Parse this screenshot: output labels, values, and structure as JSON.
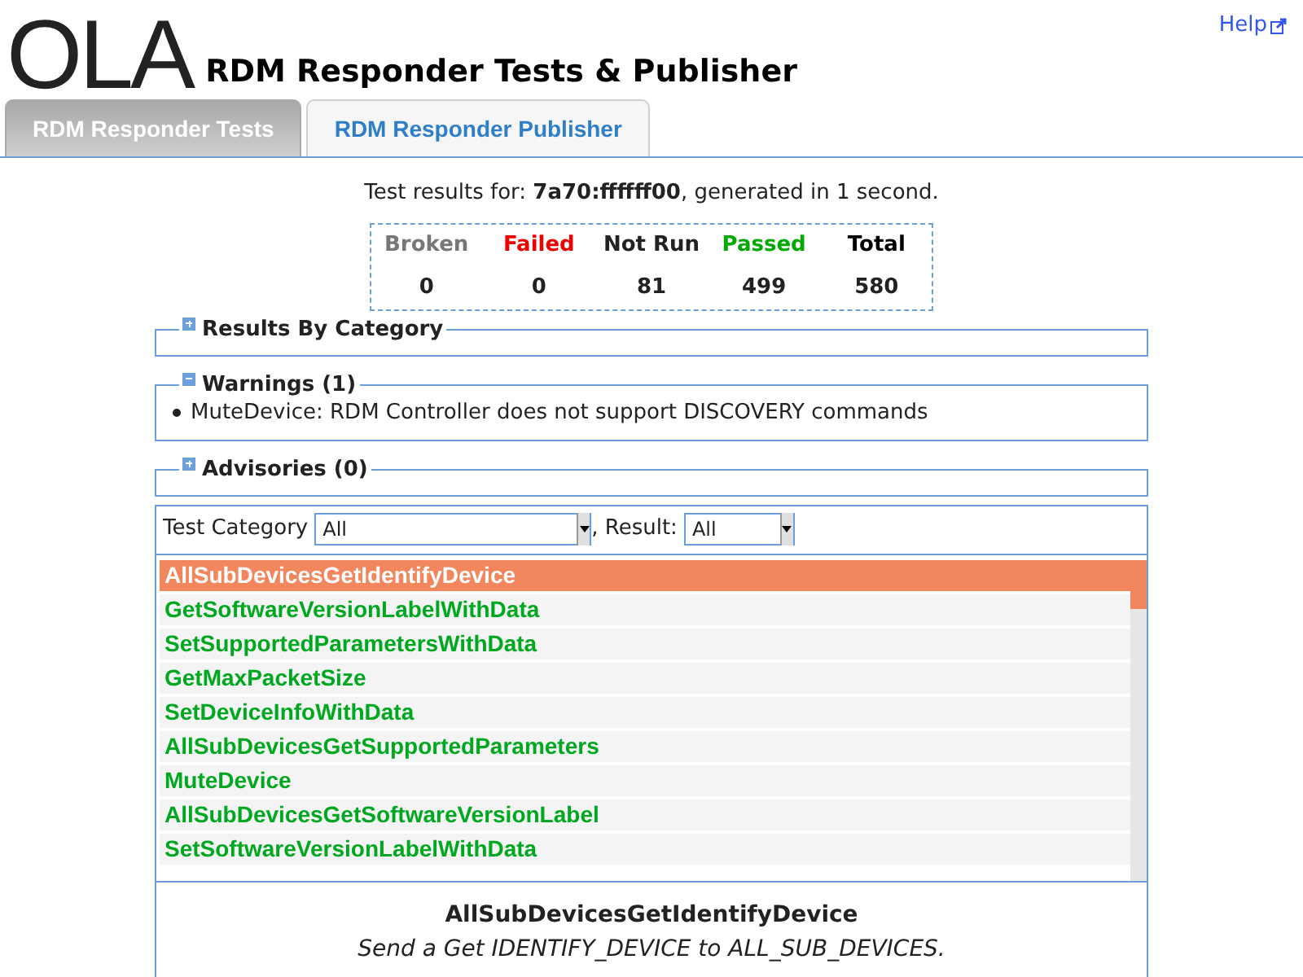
{
  "header": {
    "logo": "OLA",
    "title": "RDM Responder Tests & Publisher",
    "help_link": "Help"
  },
  "tabs": [
    {
      "label": "RDM Responder Tests",
      "selected": true
    },
    {
      "label": "RDM Responder Publisher",
      "selected": false
    }
  ],
  "summary": {
    "prefix": "Test results for: ",
    "uid": "7a70:ffffff00",
    "suffix": ", generated in 1 second."
  },
  "counts": [
    {
      "label": "Broken",
      "value": "0",
      "color": "#777777"
    },
    {
      "label": "Failed",
      "value": "0",
      "color": "#ee0000"
    },
    {
      "label": "Not Run",
      "value": "81",
      "color": "#222222"
    },
    {
      "label": "Passed",
      "value": "499",
      "color": "#00aa00"
    },
    {
      "label": "Total",
      "value": "580",
      "color": "#000000"
    }
  ],
  "sections": [
    {
      "title": "Results By Category",
      "expanded": false
    },
    {
      "title": "Warnings (1)",
      "expanded": true,
      "items": [
        "MuteDevice: RDM Controller does not support DISCOVERY commands"
      ]
    },
    {
      "title": "Advisories (0)",
      "expanded": false
    }
  ],
  "filters": {
    "category_label": "Test Category",
    "category_value": "All",
    "result_label": ", Result:",
    "result_value": "All"
  },
  "tests": [
    {
      "name": "AllSubDevicesGetIdentifyDevice",
      "kind": "passed",
      "selected": true
    },
    {
      "name": "GetSoftwareVersionLabelWithData",
      "kind": "passed",
      "selected": false
    },
    {
      "name": "SetSupportedParametersWithData",
      "kind": "passed",
      "selected": false
    },
    {
      "name": "GetMaxPacketSize",
      "kind": "passed",
      "selected": false
    },
    {
      "name": "SetDeviceInfoWithData",
      "kind": "passed",
      "selected": false
    },
    {
      "name": "AllSubDevicesGetSupportedParameters",
      "kind": "passed",
      "selected": false
    },
    {
      "name": "MuteDevice",
      "kind": "passed",
      "selected": false
    },
    {
      "name": "AllSubDevicesGetSoftwareVersionLabel",
      "kind": "passed",
      "selected": false
    },
    {
      "name": "SetSoftwareVersionLabelWithData",
      "kind": "passed",
      "selected": false
    }
  ],
  "detail": {
    "title": "AllSubDevicesGetIdentifyDevice",
    "description": "Send a Get IDENTIFY_DEVICE to ALL_SUB_DEVICES."
  }
}
